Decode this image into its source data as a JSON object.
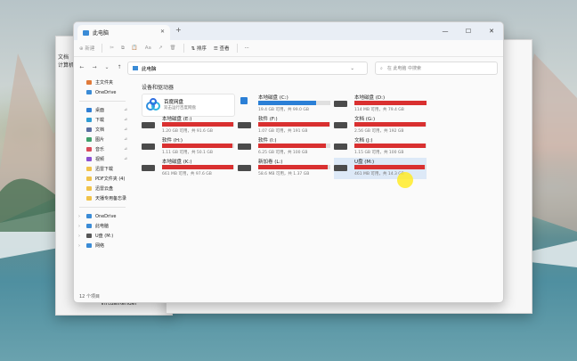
{
  "background": {
    "desc_color_sky": "#cfd6d4",
    "desc_color_sea": "#4f8fa0"
  },
  "ghost": {
    "left_title_1": "文档",
    "left_title_2": "计算机",
    "bottom_folder": "VirtualRender"
  },
  "window": {
    "tab_title": "此电脑",
    "new_tab": "+",
    "controls": {
      "minimize": "—",
      "maximize": "☐",
      "close": "✕"
    }
  },
  "toolbar": {
    "new": "⊕ 新建",
    "sort": "⇅ 排序",
    "view": "☰ 查看",
    "more": "···"
  },
  "address": {
    "path": "此电脑",
    "search_placeholder": "在 此电脑 中搜索"
  },
  "sidebar": {
    "items": [
      {
        "label": "主文件夹",
        "color": "#e07a3a"
      },
      {
        "label": "OneDrive",
        "color": "#3a8bd6"
      },
      {
        "label": "桌面",
        "color": "#2f7fd4",
        "pin": "📌"
      },
      {
        "label": "下载",
        "color": "#2f9bd4",
        "pin": "📌"
      },
      {
        "label": "文档",
        "color": "#5a6ea0",
        "pin": "📌"
      },
      {
        "label": "图片",
        "color": "#3f9f6a",
        "pin": "📌"
      },
      {
        "label": "音乐",
        "color": "#d94a5a",
        "pin": "📌"
      },
      {
        "label": "视频",
        "color": "#8a4fd0",
        "pin": "📌"
      },
      {
        "label": "迅雷下载",
        "color": "#f0c24a"
      },
      {
        "label": "PDF文件夹 (4)",
        "color": "#f0c24a"
      },
      {
        "label": "迅雷云盘",
        "color": "#f0c24a"
      },
      {
        "label": "天播专用备忘录",
        "color": "#f0c24a"
      }
    ],
    "tree": [
      {
        "label": "OneDrive",
        "color": "#3a8bd6"
      },
      {
        "label": "此电脑",
        "color": "#3a8bd6"
      },
      {
        "label": "U盘 (M:)",
        "color": "#555555"
      },
      {
        "label": "网络",
        "color": "#3a8bd6"
      }
    ]
  },
  "content": {
    "section_title": "设备和驱动器",
    "cloud": {
      "name": "百度网盘",
      "sub": "双击运行百度网盘"
    },
    "drives": [
      {
        "name": "本地磁盘 (C:)",
        "size": "19.4 GB 可用，共 99.0 GB",
        "fill": 0.8,
        "color": "#2b7fd6"
      },
      {
        "name": "本地磁盘 (D:)",
        "size": "114 MB 可用，共 79.4 GB",
        "fill": 1.0,
        "color": "#d93030"
      },
      {
        "name": "本地磁盘 (E:)",
        "size": "1.20 GB 可用，共 91.6 GB",
        "fill": 0.99,
        "color": "#d93030"
      },
      {
        "name": "软件 (F:)",
        "size": "1.07 GB 可用，共 191 GB",
        "fill": 0.99,
        "color": "#d93030"
      },
      {
        "name": "文档 (G:)",
        "size": "2.56 GB 可用，共 192 GB",
        "fill": 0.99,
        "color": "#d93030"
      },
      {
        "name": "软件 (H:)",
        "size": "1.11 GB 可用，共 50.1 GB",
        "fill": 0.98,
        "color": "#d93030"
      },
      {
        "name": "软件 (I:)",
        "size": "6.25 GB 可用，共 100 GB",
        "fill": 0.94,
        "color": "#d93030"
      },
      {
        "name": "文档 (J:)",
        "size": "1.15 GB 可用，共 100 GB",
        "fill": 0.99,
        "color": "#d93030"
      },
      {
        "name": "本地磁盘 (K:)",
        "size": "661 MB 可用，共 97.6 GB",
        "fill": 0.99,
        "color": "#d93030"
      },
      {
        "name": "新加卷 (L:)",
        "size": "58.6 MB 可用，共 1.37 GB",
        "fill": 0.96,
        "color": "#d93030"
      },
      {
        "name": "U盘 (M:)",
        "size": "461 MB 可用，共 14.3 GB",
        "fill": 0.97,
        "color": "#d93030"
      }
    ]
  },
  "status": {
    "count": "12 个项目"
  }
}
